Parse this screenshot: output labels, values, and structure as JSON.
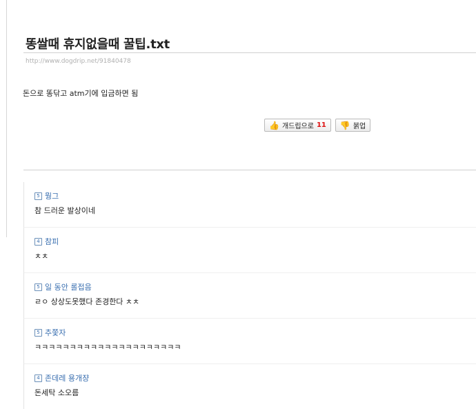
{
  "post": {
    "title": "똥쌀때 휴지없을때 꿀팁.txt",
    "url": "http://www.dogdrip.net/91840478",
    "body": "돈으로 똥닦고 atm기에 입금하면 됨"
  },
  "votes": {
    "up_label": "개드립으로",
    "up_count": "11",
    "down_label": "붉업"
  },
  "comments": [
    {
      "level": "5",
      "author": "뭥그",
      "text": "참 드러운 발상이네"
    },
    {
      "level": "4",
      "author": "참피",
      "text": "ㅊㅊ"
    },
    {
      "level": "5",
      "author": "일 동안 롤접음",
      "text": "ㄹㅇ 상상도못했다 존경한다 ㅊㅊ"
    },
    {
      "level": "5",
      "author": "추쫓자",
      "text": "ㅋㅋㅋㅋㅋㅋㅋㅋㅋㅋㅋㅋㅋㅋㅋㅋㅋㅋㅋㅋㅋ"
    },
    {
      "level": "4",
      "author": "존데레 용개쟝",
      "text": "돈세탁 소오름"
    }
  ]
}
